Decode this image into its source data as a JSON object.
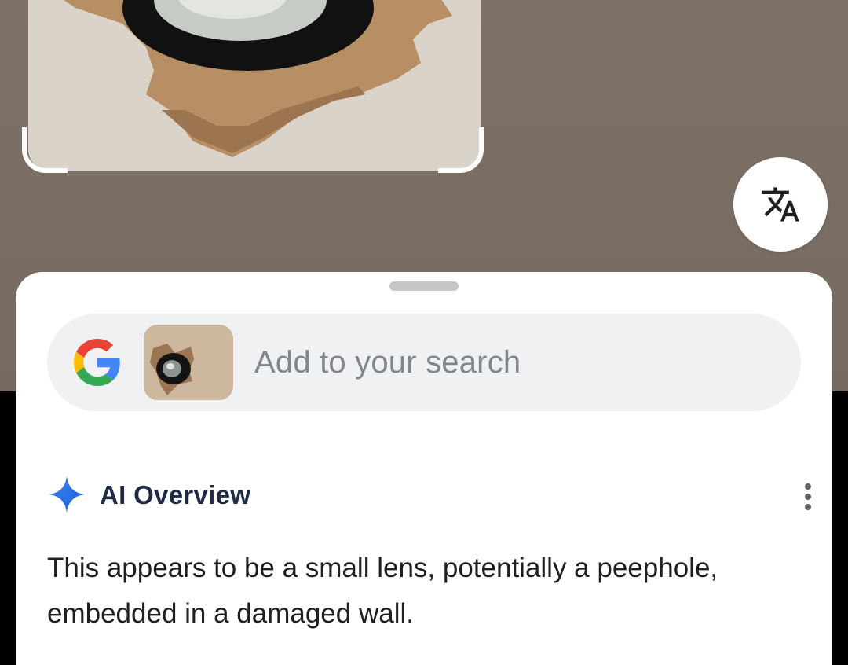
{
  "translate": {
    "icon": "translate-icon"
  },
  "search": {
    "placeholder": "Add to your search",
    "logo_icon": "google-g-icon"
  },
  "ai_overview": {
    "title": "AI Overview",
    "icon": "sparkle-icon",
    "menu_icon": "more-vert-icon",
    "text": "This appears to be a small lens, potentially a peephole, embedded in a damaged wall."
  },
  "colors": {
    "google_blue": "#4285F4",
    "google_red": "#EA4335",
    "google_yellow": "#FBBC05",
    "google_green": "#34A853",
    "sheet_bg": "#FFFFFF",
    "search_bar_bg": "#F0F1F2"
  }
}
